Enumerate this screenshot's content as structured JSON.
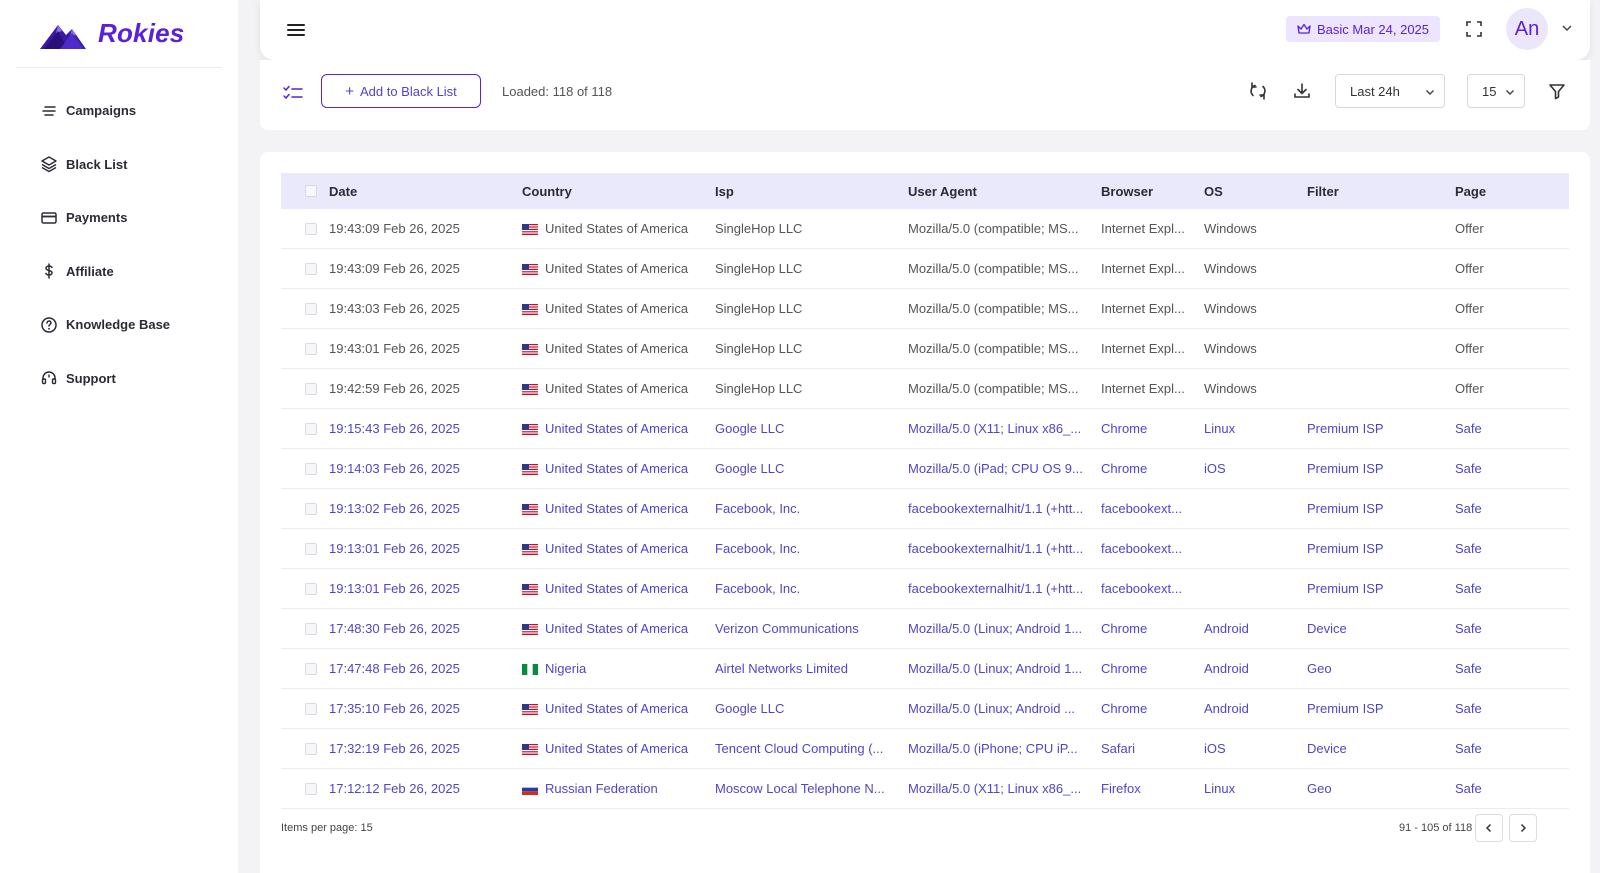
{
  "brand": {
    "name": "Rokies"
  },
  "sidebar": {
    "items": [
      {
        "label": "Campaigns",
        "icon": "lines-icon"
      },
      {
        "label": "Black List",
        "icon": "layers-icon"
      },
      {
        "label": "Payments",
        "icon": "card-icon"
      },
      {
        "label": "Affiliate",
        "icon": "dollar-icon"
      },
      {
        "label": "Knowledge Base",
        "icon": "question-circle-icon"
      },
      {
        "label": "Support",
        "icon": "headset-icon"
      }
    ]
  },
  "header": {
    "plan_badge": "Basic Mar 24, 2025",
    "avatar_initials": "An"
  },
  "toolbar": {
    "add_label": "Add to Black List",
    "loaded_text": "Loaded: 118 of 118",
    "time_range": "Last 24h",
    "per_page": "15"
  },
  "table": {
    "columns": [
      "Date",
      "Country",
      "Isp",
      "User Agent",
      "Browser",
      "OS",
      "Filter",
      "Page"
    ],
    "rows": [
      {
        "status": "neutral",
        "date": "19:43:09 Feb 26, 2025",
        "country": "United States of America",
        "flag": "us",
        "isp": "SingleHop LLC",
        "ua": "Mozilla/5.0 (compatible; MS...",
        "browser": "Internet Expl...",
        "os": "Windows",
        "filter": "",
        "page": "Offer"
      },
      {
        "status": "neutral",
        "date": "19:43:09 Feb 26, 2025",
        "country": "United States of America",
        "flag": "us",
        "isp": "SingleHop LLC",
        "ua": "Mozilla/5.0 (compatible; MS...",
        "browser": "Internet Expl...",
        "os": "Windows",
        "filter": "",
        "page": "Offer"
      },
      {
        "status": "neutral",
        "date": "19:43:03 Feb 26, 2025",
        "country": "United States of America",
        "flag": "us",
        "isp": "SingleHop LLC",
        "ua": "Mozilla/5.0 (compatible; MS...",
        "browser": "Internet Expl...",
        "os": "Windows",
        "filter": "",
        "page": "Offer"
      },
      {
        "status": "neutral",
        "date": "19:43:01 Feb 26, 2025",
        "country": "United States of America",
        "flag": "us",
        "isp": "SingleHop LLC",
        "ua": "Mozilla/5.0 (compatible; MS...",
        "browser": "Internet Expl...",
        "os": "Windows",
        "filter": "",
        "page": "Offer"
      },
      {
        "status": "neutral",
        "date": "19:42:59 Feb 26, 2025",
        "country": "United States of America",
        "flag": "us",
        "isp": "SingleHop LLC",
        "ua": "Mozilla/5.0 (compatible; MS...",
        "browser": "Internet Expl...",
        "os": "Windows",
        "filter": "",
        "page": "Offer"
      },
      {
        "status": "safe",
        "date": "19:15:43 Feb 26, 2025",
        "country": "United States of America",
        "flag": "us",
        "isp": "Google LLC",
        "ua": "Mozilla/5.0 (X11; Linux x86_...",
        "browser": "Chrome",
        "os": "Linux",
        "filter": "Premium ISP",
        "page": "Safe"
      },
      {
        "status": "safe",
        "date": "19:14:03 Feb 26, 2025",
        "country": "United States of America",
        "flag": "us",
        "isp": "Google LLC",
        "ua": "Mozilla/5.0 (iPad; CPU OS 9...",
        "browser": "Chrome",
        "os": "iOS",
        "filter": "Premium ISP",
        "page": "Safe"
      },
      {
        "status": "safe",
        "date": "19:13:02 Feb 26, 2025",
        "country": "United States of America",
        "flag": "us",
        "isp": "Facebook, Inc.",
        "ua": "facebookexternalhit/1.1 (+htt...",
        "browser": "facebookext...",
        "os": "",
        "filter": "Premium ISP",
        "page": "Safe"
      },
      {
        "status": "safe",
        "date": "19:13:01 Feb 26, 2025",
        "country": "United States of America",
        "flag": "us",
        "isp": "Facebook, Inc.",
        "ua": "facebookexternalhit/1.1 (+htt...",
        "browser": "facebookext...",
        "os": "",
        "filter": "Premium ISP",
        "page": "Safe"
      },
      {
        "status": "safe",
        "date": "19:13:01 Feb 26, 2025",
        "country": "United States of America",
        "flag": "us",
        "isp": "Facebook, Inc.",
        "ua": "facebookexternalhit/1.1 (+htt...",
        "browser": "facebookext...",
        "os": "",
        "filter": "Premium ISP",
        "page": "Safe"
      },
      {
        "status": "safe",
        "date": "17:48:30 Feb 26, 2025",
        "country": "United States of America",
        "flag": "us",
        "isp": "Verizon Communications",
        "ua": "Mozilla/5.0 (Linux; Android 1...",
        "browser": "Chrome",
        "os": "Android",
        "filter": "Device",
        "page": "Safe"
      },
      {
        "status": "safe",
        "date": "17:47:48 Feb 26, 2025",
        "country": "Nigeria",
        "flag": "ng",
        "isp": "Airtel Networks Limited",
        "ua": "Mozilla/5.0 (Linux; Android 1...",
        "browser": "Chrome",
        "os": "Android",
        "filter": "Geo",
        "page": "Safe"
      },
      {
        "status": "safe",
        "date": "17:35:10 Feb 26, 2025",
        "country": "United States of America",
        "flag": "us",
        "isp": "Google LLC",
        "ua": "Mozilla/5.0 (Linux; Android ...",
        "browser": "Chrome",
        "os": "Android",
        "filter": "Premium ISP",
        "page": "Safe"
      },
      {
        "status": "safe",
        "date": "17:32:19 Feb 26, 2025",
        "country": "United States of America",
        "flag": "us",
        "isp": "Tencent Cloud Computing (...",
        "ua": "Mozilla/5.0 (iPhone; CPU iP...",
        "browser": "Safari",
        "os": "iOS",
        "filter": "Device",
        "page": "Safe"
      },
      {
        "status": "safe",
        "date": "17:12:12 Feb 26, 2025",
        "country": "Russian Federation",
        "flag": "ru",
        "isp": "Moscow Local Telephone N...",
        "ua": "Mozilla/5.0 (X11; Linux x86_...",
        "browser": "Firefox",
        "os": "Linux",
        "filter": "Geo",
        "page": "Safe"
      }
    ]
  },
  "footer": {
    "items_per_page": "Items per page: 15",
    "range": "91 - 105 of 118"
  },
  "colors": {
    "accent": "#5b21d6",
    "link": "#4f46c8",
    "header_bg": "#e9e9fb"
  }
}
